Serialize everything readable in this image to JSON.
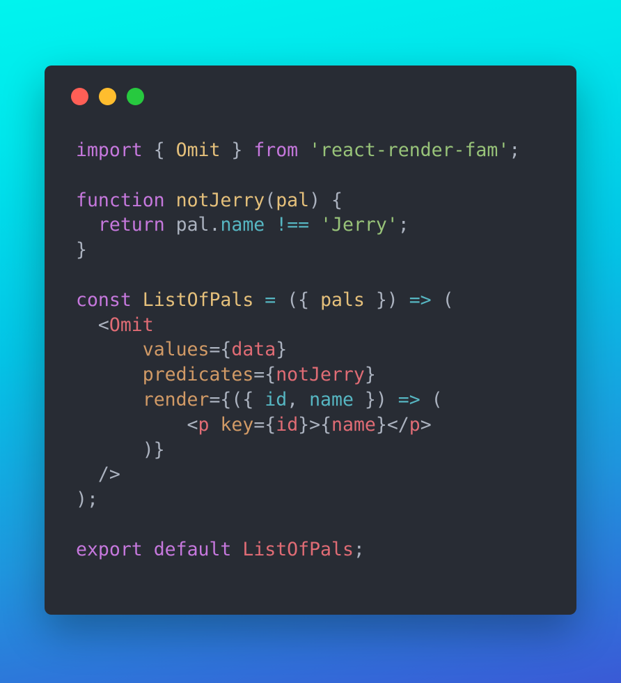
{
  "colors": {
    "window_bg": "#282c34",
    "close": "#ff5f56",
    "minimize": "#ffbd2e",
    "maximize": "#27c93f",
    "keyword": "#c678dd",
    "plain": "#abb2bf",
    "function_name": "#e5c07b",
    "string": "#98c379",
    "property": "#56b6c2",
    "operator": "#56b6c2",
    "jsx_tag": "#e06c75",
    "jsx_attr": "#d19a66",
    "variable": "#e06c75"
  },
  "window_controls": {
    "close_icon": "close-dot-icon",
    "minimize_icon": "minimize-dot-icon",
    "maximize_icon": "maximize-dot-icon"
  },
  "code": {
    "lines": [
      [
        {
          "t": "import",
          "c": "keyword"
        },
        {
          "t": " { ",
          "c": "plain"
        },
        {
          "t": "Omit",
          "c": "function_name"
        },
        {
          "t": " } ",
          "c": "plain"
        },
        {
          "t": "from",
          "c": "keyword"
        },
        {
          "t": " ",
          "c": "plain"
        },
        {
          "t": "'react-render-fam'",
          "c": "string"
        },
        {
          "t": ";",
          "c": "plain"
        }
      ],
      [],
      [
        {
          "t": "function",
          "c": "keyword"
        },
        {
          "t": " ",
          "c": "plain"
        },
        {
          "t": "notJerry",
          "c": "function_name"
        },
        {
          "t": "(",
          "c": "plain"
        },
        {
          "t": "pal",
          "c": "function_name"
        },
        {
          "t": ") {",
          "c": "plain"
        }
      ],
      [
        {
          "t": "  ",
          "c": "plain"
        },
        {
          "t": "return",
          "c": "keyword"
        },
        {
          "t": " pal.",
          "c": "plain"
        },
        {
          "t": "name",
          "c": "property"
        },
        {
          "t": " ",
          "c": "plain"
        },
        {
          "t": "!==",
          "c": "operator"
        },
        {
          "t": " ",
          "c": "plain"
        },
        {
          "t": "'Jerry'",
          "c": "string"
        },
        {
          "t": ";",
          "c": "plain"
        }
      ],
      [
        {
          "t": "}",
          "c": "plain"
        }
      ],
      [],
      [
        {
          "t": "const",
          "c": "keyword"
        },
        {
          "t": " ",
          "c": "plain"
        },
        {
          "t": "ListOfPals",
          "c": "function_name"
        },
        {
          "t": " ",
          "c": "plain"
        },
        {
          "t": "=",
          "c": "operator"
        },
        {
          "t": " ({ ",
          "c": "plain"
        },
        {
          "t": "pals",
          "c": "function_name"
        },
        {
          "t": " }) ",
          "c": "plain"
        },
        {
          "t": "=>",
          "c": "operator"
        },
        {
          "t": " (",
          "c": "plain"
        }
      ],
      [
        {
          "t": "  <",
          "c": "plain"
        },
        {
          "t": "Omit",
          "c": "jsx_tag"
        }
      ],
      [
        {
          "t": "      ",
          "c": "plain"
        },
        {
          "t": "values",
          "c": "jsx_attr"
        },
        {
          "t": "={",
          "c": "plain"
        },
        {
          "t": "data",
          "c": "variable"
        },
        {
          "t": "}",
          "c": "plain"
        }
      ],
      [
        {
          "t": "      ",
          "c": "plain"
        },
        {
          "t": "predicates",
          "c": "jsx_attr"
        },
        {
          "t": "={",
          "c": "plain"
        },
        {
          "t": "notJerry",
          "c": "variable"
        },
        {
          "t": "}",
          "c": "plain"
        }
      ],
      [
        {
          "t": "      ",
          "c": "plain"
        },
        {
          "t": "render",
          "c": "jsx_attr"
        },
        {
          "t": "={({ ",
          "c": "plain"
        },
        {
          "t": "id",
          "c": "property"
        },
        {
          "t": ", ",
          "c": "plain"
        },
        {
          "t": "name",
          "c": "property"
        },
        {
          "t": " }) ",
          "c": "plain"
        },
        {
          "t": "=>",
          "c": "operator"
        },
        {
          "t": " (",
          "c": "plain"
        }
      ],
      [
        {
          "t": "          <",
          "c": "plain"
        },
        {
          "t": "p",
          "c": "jsx_tag"
        },
        {
          "t": " ",
          "c": "plain"
        },
        {
          "t": "key",
          "c": "jsx_attr"
        },
        {
          "t": "={",
          "c": "plain"
        },
        {
          "t": "id",
          "c": "variable"
        },
        {
          "t": "}>{",
          "c": "plain"
        },
        {
          "t": "name",
          "c": "variable"
        },
        {
          "t": "}</",
          "c": "plain"
        },
        {
          "t": "p",
          "c": "jsx_tag"
        },
        {
          "t": ">",
          "c": "plain"
        }
      ],
      [
        {
          "t": "      )}",
          "c": "plain"
        }
      ],
      [
        {
          "t": "  />",
          "c": "plain"
        }
      ],
      [
        {
          "t": ");",
          "c": "plain"
        }
      ],
      [],
      [
        {
          "t": "export",
          "c": "keyword"
        },
        {
          "t": " ",
          "c": "plain"
        },
        {
          "t": "default",
          "c": "keyword"
        },
        {
          "t": " ",
          "c": "plain"
        },
        {
          "t": "ListOfPals",
          "c": "variable"
        },
        {
          "t": ";",
          "c": "plain"
        }
      ]
    ]
  }
}
